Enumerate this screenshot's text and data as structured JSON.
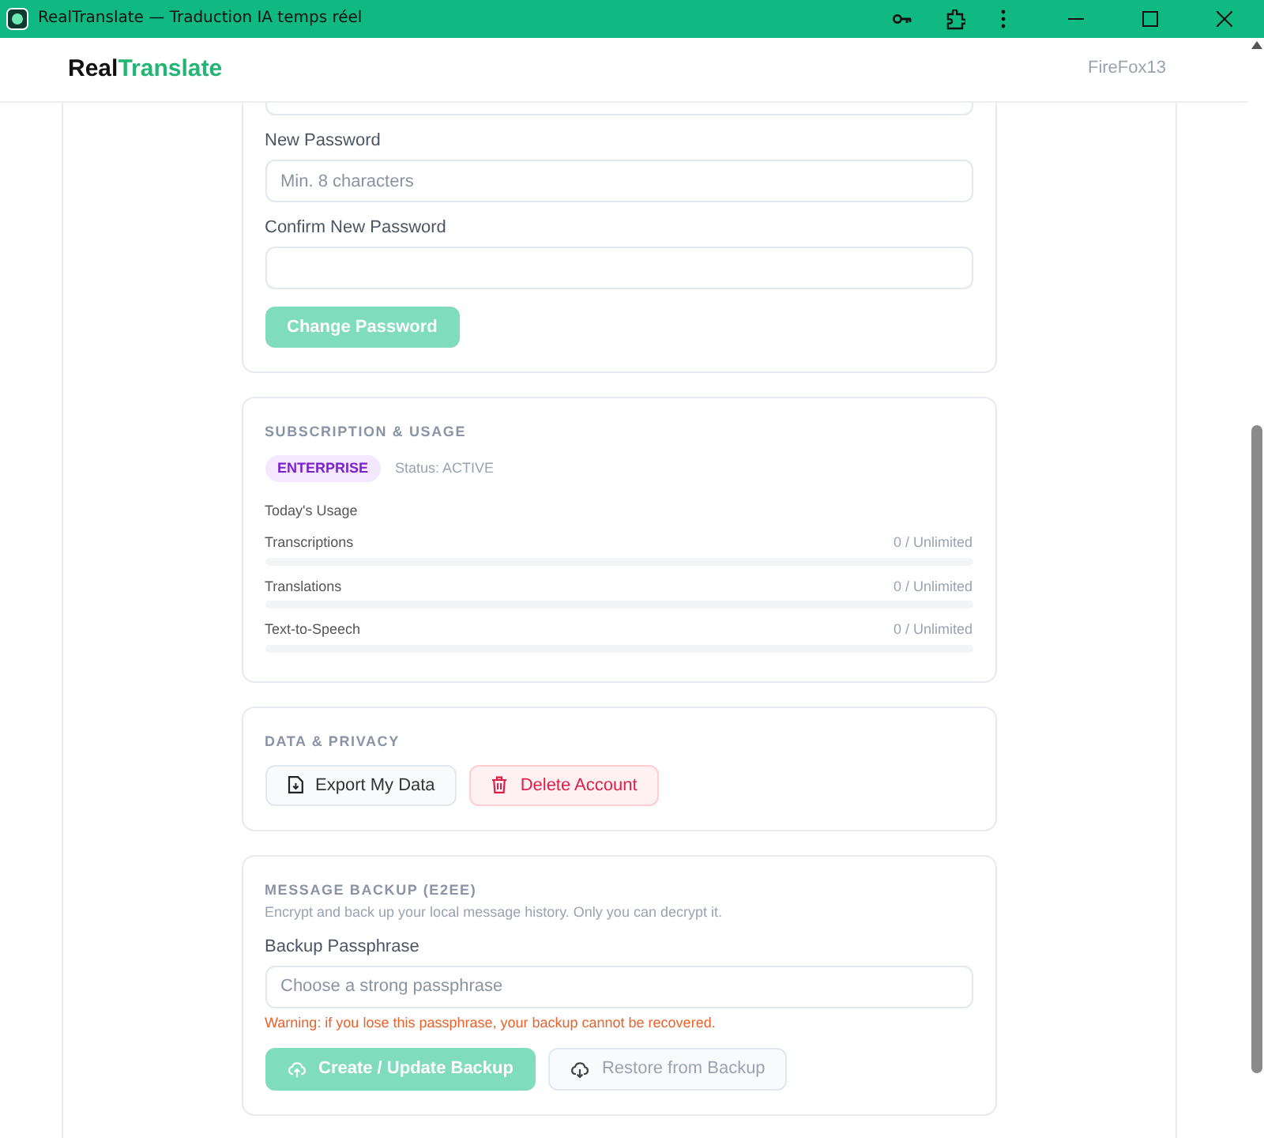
{
  "window": {
    "title": "RealTranslate — Traduction IA temps réel"
  },
  "header": {
    "logo_parts": [
      "Real",
      "Translate"
    ],
    "user": "FireFox13"
  },
  "password_card": {
    "fields": [
      {
        "label": "New Password",
        "placeholder": "Min. 8 characters"
      },
      {
        "label": "Confirm New Password"
      }
    ],
    "button": {
      "label": "Change Password",
      "disabled": true
    }
  },
  "subscription": {
    "heading": "SUBSCRIPTION & USAGE",
    "plan": "ENTERPRISE",
    "status": "Status: ACTIVE",
    "usage_title": "Today's Usage",
    "usage": [
      {
        "name": "Transcriptions",
        "reading": "0 / Unlimited",
        "level": 0
      },
      {
        "name": "Translations",
        "reading": "0 / Unlimited",
        "level": 0
      },
      {
        "name": "Text-to-Speech",
        "reading": "0 / Unlimited",
        "level": 0
      }
    ]
  },
  "privacy": {
    "heading": "DATA & PRIVACY",
    "buttons": [
      {
        "label": "Export My Data",
        "kind": "export"
      },
      {
        "label": "Delete Account",
        "kind": "delete"
      }
    ]
  },
  "backup": {
    "heading": "MESSAGE BACKUP (E2EE)",
    "description": "Encrypt and back up your local message history. Only you can decrypt it.",
    "field_label": "Backup Passphrase",
    "placeholder": "Choose a strong passphrase",
    "warning": "Warning: if you lose this passphrase, your backup cannot be recovered.",
    "buttons": [
      {
        "label": "Create / Update Backup",
        "kind": "create",
        "disabled": true
      },
      {
        "label": "Restore from Backup",
        "kind": "restore",
        "disabled": true
      }
    ]
  }
}
